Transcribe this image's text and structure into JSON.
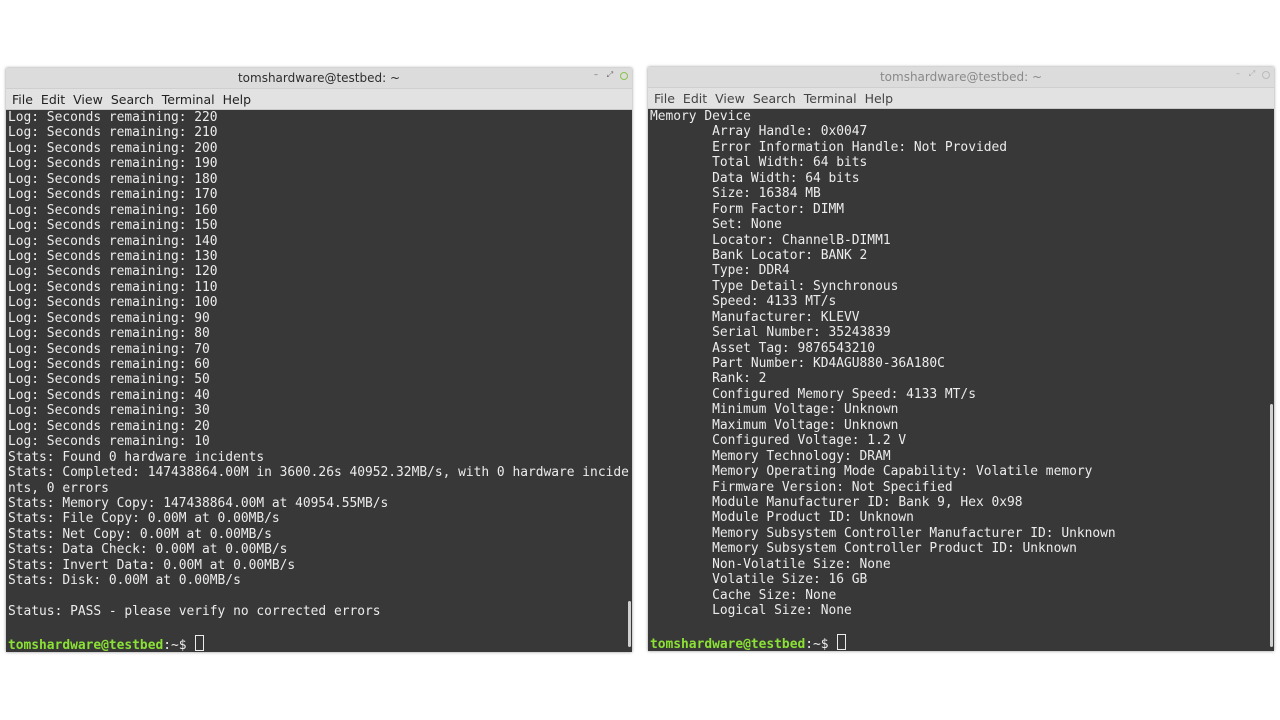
{
  "left": {
    "title": "tomshardware@testbed: ~",
    "menu": [
      "File",
      "Edit",
      "View",
      "Search",
      "Terminal",
      "Help"
    ],
    "lines": [
      "Log: Seconds remaining: 220",
      "Log: Seconds remaining: 210",
      "Log: Seconds remaining: 200",
      "Log: Seconds remaining: 190",
      "Log: Seconds remaining: 180",
      "Log: Seconds remaining: 170",
      "Log: Seconds remaining: 160",
      "Log: Seconds remaining: 150",
      "Log: Seconds remaining: 140",
      "Log: Seconds remaining: 130",
      "Log: Seconds remaining: 120",
      "Log: Seconds remaining: 110",
      "Log: Seconds remaining: 100",
      "Log: Seconds remaining: 90",
      "Log: Seconds remaining: 80",
      "Log: Seconds remaining: 70",
      "Log: Seconds remaining: 60",
      "Log: Seconds remaining: 50",
      "Log: Seconds remaining: 40",
      "Log: Seconds remaining: 30",
      "Log: Seconds remaining: 20",
      "Log: Seconds remaining: 10",
      "Stats: Found 0 hardware incidents",
      "Stats: Completed: 147438864.00M in 3600.26s 40952.32MB/s, with 0 hardware incide",
      "nts, 0 errors",
      "Stats: Memory Copy: 147438864.00M at 40954.55MB/s",
      "Stats: File Copy: 0.00M at 0.00MB/s",
      "Stats: Net Copy: 0.00M at 0.00MB/s",
      "Stats: Data Check: 0.00M at 0.00MB/s",
      "Stats: Invert Data: 0.00M at 0.00MB/s",
      "Stats: Disk: 0.00M at 0.00MB/s",
      "",
      "Status: PASS - please verify no corrected errors",
      ""
    ],
    "prompt_user": "tomshardware@testbed",
    "prompt_symbol": ":~$ "
  },
  "right": {
    "title": "tomshardware@testbed: ~",
    "menu": [
      "File",
      "Edit",
      "View",
      "Search",
      "Terminal",
      "Help"
    ],
    "lines": [
      "Memory Device",
      "        Array Handle: 0x0047",
      "        Error Information Handle: Not Provided",
      "        Total Width: 64 bits",
      "        Data Width: 64 bits",
      "        Size: 16384 MB",
      "        Form Factor: DIMM",
      "        Set: None",
      "        Locator: ChannelB-DIMM1",
      "        Bank Locator: BANK 2",
      "        Type: DDR4",
      "        Type Detail: Synchronous",
      "        Speed: 4133 MT/s",
      "        Manufacturer: KLEVV",
      "        Serial Number: 35243839",
      "        Asset Tag: 9876543210",
      "        Part Number: KD4AGU880-36A180C",
      "        Rank: 2",
      "        Configured Memory Speed: 4133 MT/s",
      "        Minimum Voltage: Unknown",
      "        Maximum Voltage: Unknown",
      "        Configured Voltage: 1.2 V",
      "        Memory Technology: DRAM",
      "        Memory Operating Mode Capability: Volatile memory",
      "        Firmware Version: Not Specified",
      "        Module Manufacturer ID: Bank 9, Hex 0x98",
      "        Module Product ID: Unknown",
      "        Memory Subsystem Controller Manufacturer ID: Unknown",
      "        Memory Subsystem Controller Product ID: Unknown",
      "        Non-Volatile Size: None",
      "        Volatile Size: 16 GB",
      "        Cache Size: None",
      "        Logical Size: None",
      ""
    ],
    "prompt_user": "tomshardware@testbed",
    "prompt_symbol": ":~$ "
  },
  "colors": {
    "terminal_bg": "#383838",
    "prompt_user": "#8ae234",
    "text": "#ececec"
  }
}
